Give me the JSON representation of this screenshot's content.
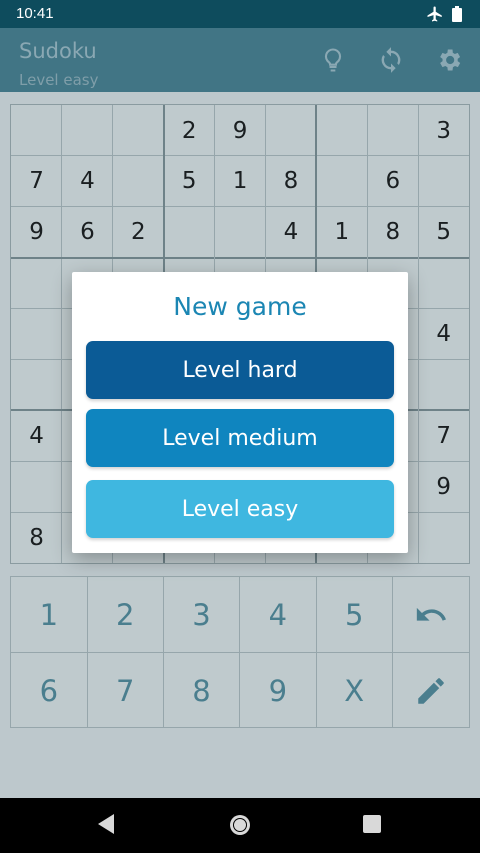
{
  "status_bar": {
    "time": "10:41",
    "icons": [
      "airplane-mode-icon",
      "battery-icon"
    ]
  },
  "app_bar": {
    "title": "Sudoku",
    "subtitle": "Level easy",
    "actions": [
      {
        "name": "hint",
        "icon": "lightbulb-icon"
      },
      {
        "name": "restart",
        "icon": "refresh-icon"
      },
      {
        "name": "settings",
        "icon": "gear-icon"
      }
    ]
  },
  "board": {
    "rows": [
      [
        "",
        "",
        "",
        "2",
        "9",
        "",
        "",
        "",
        "3"
      ],
      [
        "7",
        "4",
        "",
        "5",
        "1",
        "8",
        "",
        "6",
        ""
      ],
      [
        "9",
        "6",
        "2",
        "",
        "",
        "4",
        "1",
        "8",
        "5"
      ],
      [
        "",
        "",
        "",
        "",
        "",
        "",
        "",
        "",
        ""
      ],
      [
        "",
        "",
        "",
        "",
        "",
        "",
        "",
        "",
        "4"
      ],
      [
        "",
        "",
        "",
        "",
        "",
        "",
        "",
        "",
        ""
      ],
      [
        "4",
        "",
        "",
        "",
        "",
        "",
        "",
        "",
        "7"
      ],
      [
        "",
        "",
        "",
        "",
        "",
        "",
        "",
        "",
        "9"
      ],
      [
        "8",
        "",
        "",
        "",
        "",
        "",
        "",
        "",
        ""
      ]
    ]
  },
  "keypad": {
    "keys": [
      "1",
      "2",
      "3",
      "4",
      "5",
      "undo",
      "6",
      "7",
      "8",
      "9",
      "X",
      "pencil"
    ]
  },
  "dialog": {
    "title": "New game",
    "buttons": [
      {
        "label": "Level hard",
        "color": "#0b5b96"
      },
      {
        "label": "Level medium",
        "color": "#0f85bf"
      },
      {
        "label": "Level easy",
        "color": "#3fb7e0"
      }
    ]
  },
  "colors": {
    "status_bar": "#0e4c5d",
    "app_bar": "#417585",
    "dim_background": "#bdc8cc",
    "digit_blue": "#4a7e8e",
    "dialog_title": "#1b86b3"
  }
}
